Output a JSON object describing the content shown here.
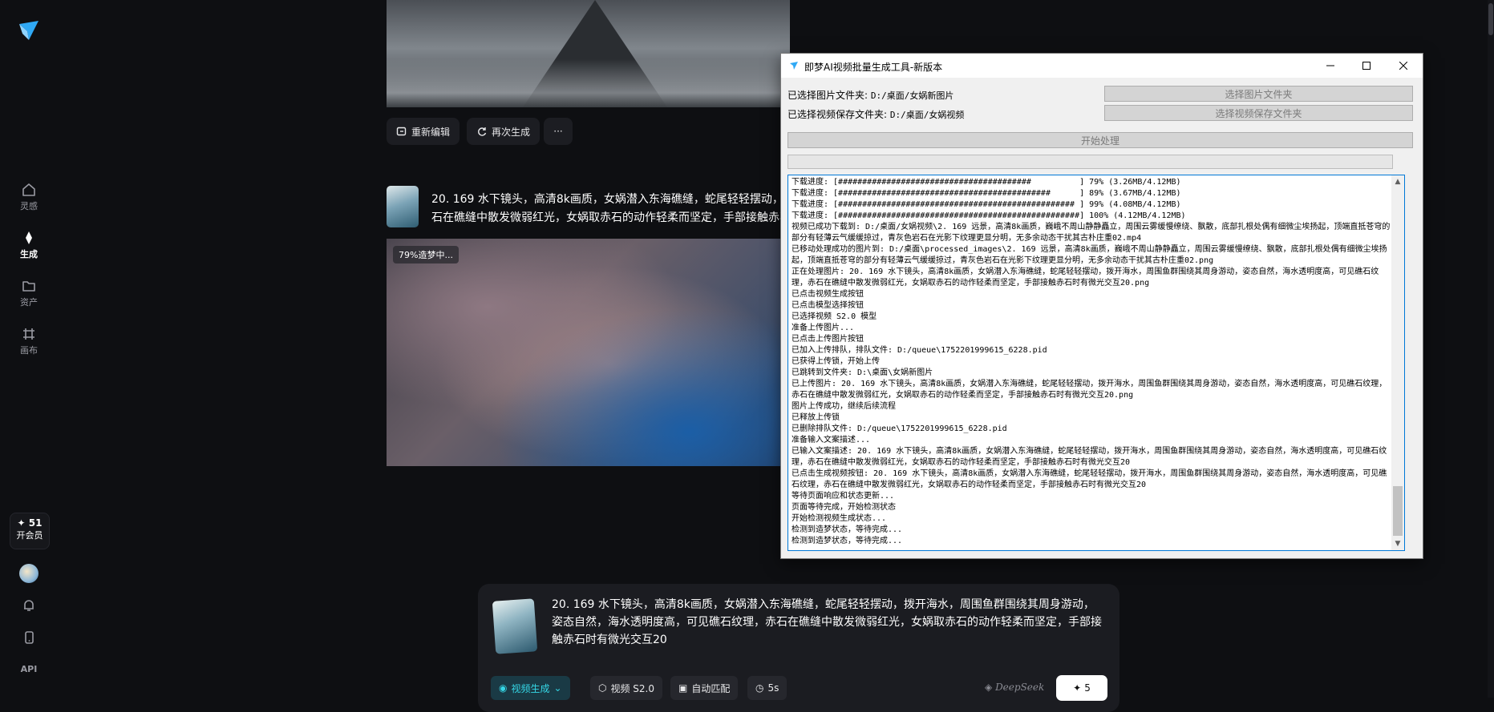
{
  "sidebar": {
    "items": [
      {
        "label": "灵感",
        "icon": "lightbulb-icon"
      },
      {
        "label": "生成",
        "icon": "sparkle-icon"
      },
      {
        "label": "资产",
        "icon": "folder-icon"
      },
      {
        "label": "画布",
        "icon": "canvas-icon"
      }
    ],
    "vip_count": "51",
    "vip_label": "开会员",
    "api_label": "API"
  },
  "toolbar": {
    "re_edit": "重新编辑",
    "regenerate": "再次生成",
    "more": "···"
  },
  "item": {
    "title": "20. 169 水下镜头，高清8k画质，女娲潜入东海礁缝，蛇尾轻轻摆动，拨开海水，周围鱼群围绕其周身游动，",
    "title_line2": "石在礁缝中散发微弱红光，女娲取赤石的动作轻柔而坚定，手部接触赤石时有微光交互20",
    "status": "79%造梦中..."
  },
  "prompt": {
    "text": "20. 169 水下镜头，高清8k画质，女娲潜入东海礁缝，蛇尾轻轻摆动，拨开海水，周围鱼群围绕其周身游动，姿态自然，海水透明度高，可见礁石纹理，赤石在礁缝中散发微弱红光，女娲取赤石的动作轻柔而坚定，手部接触赤石时有微光交互20",
    "mode": "视频生成",
    "model": "视频 S2.0",
    "ratio": "自动匹配",
    "duration": "5s",
    "brand": "DeepSeek",
    "send_count": "5"
  },
  "dialog": {
    "title": "即梦AI视频批量生成工具-新版本",
    "image_folder_label": "已选择图片文件夹:",
    "image_folder_path": "D:/桌面/女娲新图片",
    "video_folder_label": "已选择视频保存文件夹:",
    "video_folder_path": "D:/桌面/女娲视频",
    "choose_image_btn": "选择图片文件夹",
    "choose_video_btn": "选择视频保存文件夹",
    "start_btn": "开始处理",
    "progress": 0,
    "log": [
      "下载进度: [########################################          ] 79% (3.26MB/4.12MB)",
      "下载进度: [############################################      ] 89% (3.67MB/4.12MB)",
      "下载进度: [################################################# ] 99% (4.08MB/4.12MB)",
      "下载进度: [##################################################] 100% (4.12MB/4.12MB)",
      "视频已成功下载到: D:/桌面/女娲视频\\2. 169 远景，高清8k画质，巍峨不周山静静矗立，周围云雾缓慢缭绕、飘散，底部扎根处偶有细微尘埃扬起，顶端直抵苍穹的部分有轻薄云气缓缓掠过，青灰色岩石在光影下纹理更显分明，无多余动态干扰其古朴庄重02.mp4",
      "已移动处理成功的图片到: D:/桌面\\processed_images\\2. 169 远景，高清8k画质，巍峨不周山静静矗立，周围云雾缓慢缭绕、飘散，底部扎根处偶有细微尘埃扬起，顶端直抵苍穹的部分有轻薄云气缓缓掠过，青灰色岩石在光影下纹理更显分明，无多余动态干扰其古朴庄重02.png",
      "正在处理图片: 20. 169 水下镜头，高清8k画质，女娲潜入东海礁缝，蛇尾轻轻摆动，拨开海水，周围鱼群围绕其周身游动，姿态自然，海水透明度高，可见礁石纹理，赤石在礁缝中散发微弱红光，女娲取赤石的动作轻柔而坚定，手部接触赤石时有微光交互20.png",
      "已点击视频生成按钮",
      "已点击模型选择按钮",
      "已选择视频 S2.0 模型",
      "准备上传图片...",
      "已点击上传图片按钮",
      "已加入上传排队，排队文件: D:/queue\\1752201999615_6228.pid",
      "已获得上传锁，开始上传",
      "已跳转到文件夹: D:\\桌面\\女娲新图片",
      "已上传图片: 20. 169 水下镜头，高清8k画质，女娲潜入东海礁缝，蛇尾轻轻摆动，拨开海水，周围鱼群围绕其周身游动，姿态自然，海水透明度高，可见礁石纹理，赤石在礁缝中散发微弱红光，女娲取赤石的动作轻柔而坚定，手部接触赤石时有微光交互20.png",
      "图片上传成功，继续后续流程",
      "已释放上传锁",
      "已删除排队文件: D:/queue\\1752201999615_6228.pid",
      "准备输入文案描述...",
      "已输入文案描述: 20. 169 水下镜头，高清8k画质，女娲潜入东海礁缝，蛇尾轻轻摆动，拨开海水，周围鱼群围绕其周身游动，姿态自然，海水透明度高，可见礁石纹理，赤石在礁缝中散发微弱红光，女娲取赤石的动作轻柔而坚定，手部接触赤石时有微光交互20",
      "已点击生成视频按钮: 20. 169 水下镜头，高清8k画质，女娲潜入东海礁缝，蛇尾轻轻摆动，拨开海水，周围鱼群围绕其周身游动，姿态自然，海水透明度高，可见礁石纹理，赤石在礁缝中散发微弱红光，女娲取赤石的动作轻柔而坚定，手部接触赤石时有微光交互20",
      "等待页面响应和状态更新...",
      "页面等待完成，开始检测状态",
      "开始检测视频生成状态...",
      "检测到造梦状态，等待完成...",
      "检测到造梦状态，等待完成..."
    ]
  },
  "colors": {
    "accent": "#35d7e6",
    "dialog_focus": "#0078d7"
  }
}
